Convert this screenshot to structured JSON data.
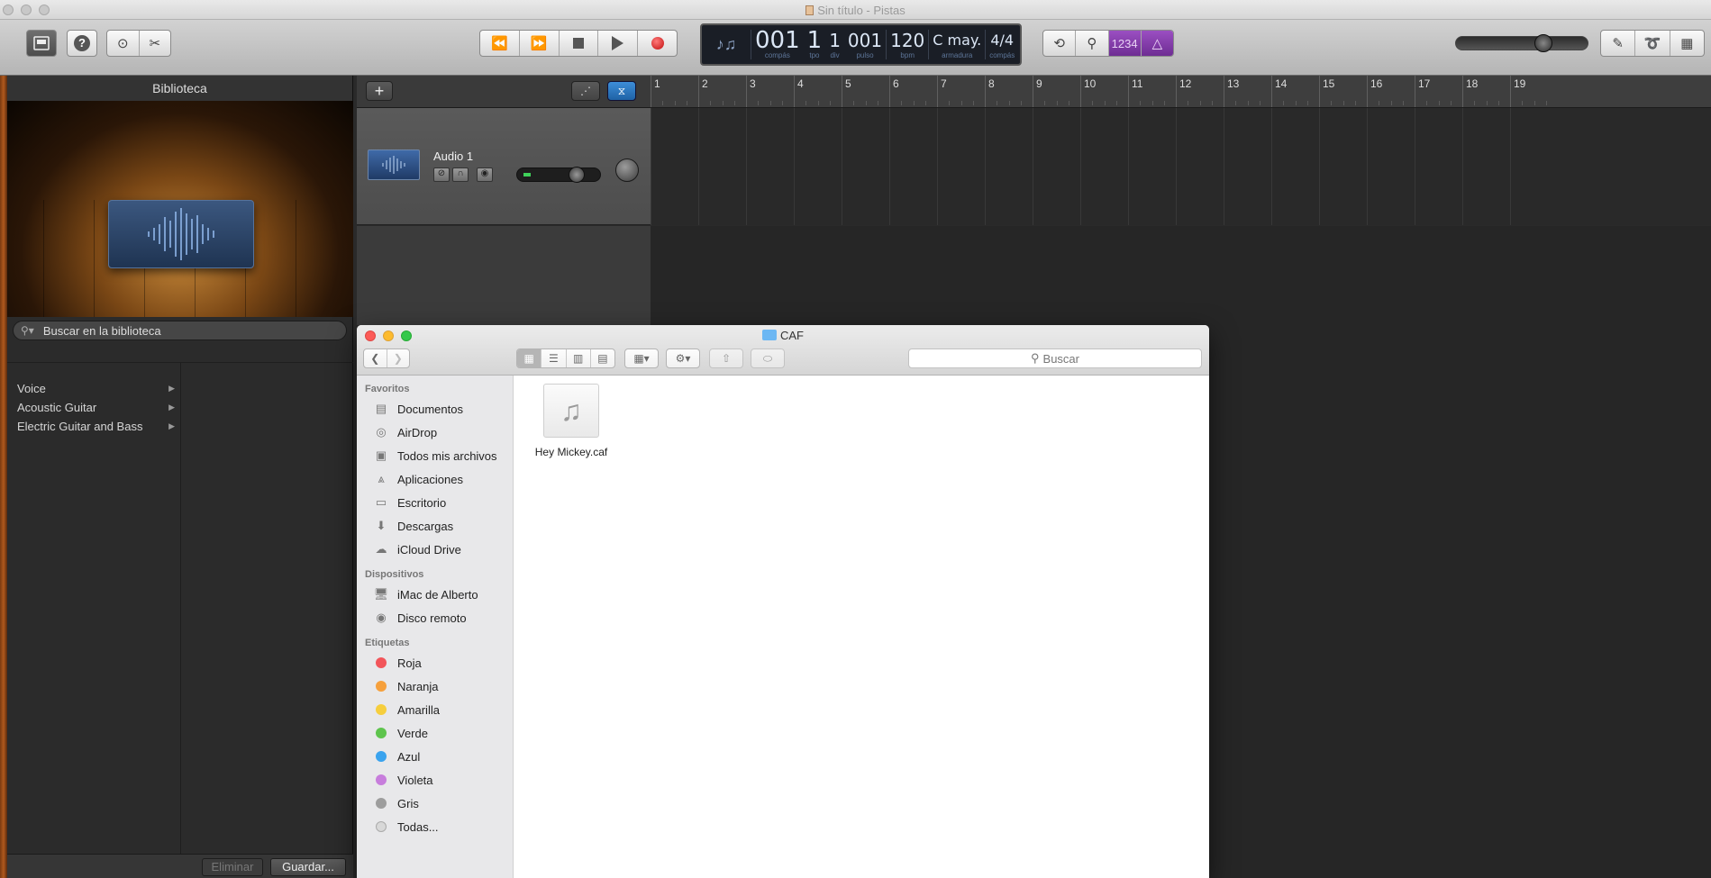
{
  "window": {
    "title": "Sin título - Pistas"
  },
  "lcd": {
    "bar": "001",
    "bar_label": "compás",
    "beat": "1",
    "beat_label": "tpo",
    "div": "1",
    "div_label": "div",
    "tick": "001",
    "tick_label": "pulso",
    "tempo": "120",
    "tempo_label": "bpm",
    "key": "C may.",
    "key_label": "armadura",
    "signature": "4/4",
    "signature_label": "compás"
  },
  "count_in": "1234",
  "library": {
    "title": "Biblioteca",
    "search_placeholder": "Buscar en la biblioteca",
    "items": [
      {
        "label": "Voice"
      },
      {
        "label": "Acoustic Guitar"
      },
      {
        "label": "Electric Guitar and Bass"
      }
    ],
    "delete_label": "Eliminar",
    "save_label": "Guardar..."
  },
  "track": {
    "name": "Audio 1"
  },
  "ruler": {
    "bars": [
      "1",
      "2",
      "3",
      "4",
      "5",
      "6",
      "7",
      "8",
      "9",
      "10",
      "11",
      "12",
      "13",
      "14",
      "15",
      "16",
      "17",
      "18",
      "19"
    ]
  },
  "finder": {
    "title": "CAF",
    "search_placeholder": "Buscar",
    "sections": {
      "favorites": "Favoritos",
      "devices": "Dispositivos",
      "tags": "Etiquetas"
    },
    "favorites": [
      {
        "label": "Documentos",
        "icon": "documents-icon"
      },
      {
        "label": "AirDrop",
        "icon": "airdrop-icon"
      },
      {
        "label": "Todos mis archivos",
        "icon": "all-files-icon"
      },
      {
        "label": "Aplicaciones",
        "icon": "applications-icon"
      },
      {
        "label": "Escritorio",
        "icon": "desktop-icon"
      },
      {
        "label": "Descargas",
        "icon": "downloads-icon"
      },
      {
        "label": "iCloud Drive",
        "icon": "icloud-icon"
      }
    ],
    "devices": [
      {
        "label": "iMac de Alberto",
        "icon": "imac-icon"
      },
      {
        "label": "Disco remoto",
        "icon": "remote-disc-icon"
      }
    ],
    "tags": [
      {
        "label": "Roja",
        "color": "#f2555a"
      },
      {
        "label": "Naranja",
        "color": "#f6a03c"
      },
      {
        "label": "Amarilla",
        "color": "#f6ce3d"
      },
      {
        "label": "Verde",
        "color": "#5ec44d"
      },
      {
        "label": "Azul",
        "color": "#3aa3ee"
      },
      {
        "label": "Violeta",
        "color": "#c77ddc"
      },
      {
        "label": "Gris",
        "color": "#9d9d9d"
      },
      {
        "label": "Todas...",
        "color": "#d8d8d8"
      }
    ],
    "files": [
      {
        "name": "Hey Mickey.caf",
        "icon": "music-note-icon"
      }
    ]
  },
  "master_volume": 0.68
}
